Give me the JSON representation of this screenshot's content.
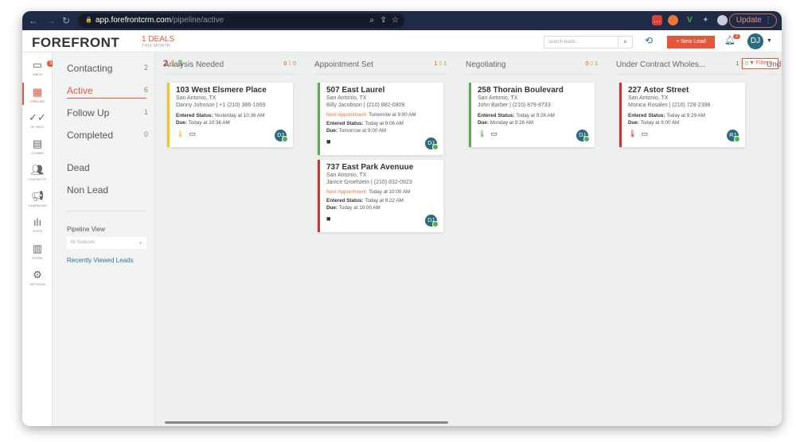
{
  "browser": {
    "url_host": "app.forefrontcrm.com",
    "url_path": "/pipeline/active",
    "update_label": "Update"
  },
  "header": {
    "logo": "FOREFRONT",
    "deals": "1 DEALS",
    "deals_sub": "THIS MONTH",
    "search_placeholder": "search leads...",
    "new_lead": "+ New Lead",
    "notif_count": "2",
    "user_initials": "DJ"
  },
  "rail": [
    {
      "label": "INBOX",
      "badge": "3"
    },
    {
      "label": "PIPELINE"
    },
    {
      "label": "UP NEXT"
    },
    {
      "label": "COMMS"
    },
    {
      "label": "CONTACTS"
    },
    {
      "label": "CAMPAIGNS"
    },
    {
      "label": "STATS"
    },
    {
      "label": "STORE"
    },
    {
      "label": "SETTINGS"
    }
  ],
  "statuses": [
    {
      "label": "Contacting",
      "count": "2"
    },
    {
      "label": "Active",
      "count": "6"
    },
    {
      "label": "Follow Up",
      "count": "1"
    },
    {
      "label": "Completed",
      "count": "0"
    },
    {
      "label": "Dead"
    },
    {
      "label": "Non Lead"
    }
  ],
  "pipeline_view": {
    "label": "Pipeline View",
    "value": "All Statuses",
    "recent": "Recently Viewed Leads"
  },
  "summary": {
    "red": "2",
    "yellow": "1",
    "green": "3"
  },
  "filters": "Filters",
  "columns": [
    {
      "title": "Analysis Needed",
      "counts": [
        "0",
        "1",
        "0"
      ],
      "cards": [
        {
          "address": "103 West Elsmere Place",
          "city": "San Antonio, TX",
          "contact": "Danny Johnson | +1 (210) 386-1069",
          "entered_label": "Entered Status:",
          "entered": "Yesterday at 10:36 AM",
          "due_label": "Due:",
          "due": "Today at 10:36 AM",
          "avatar": "DJ",
          "color": "#f2c230"
        }
      ]
    },
    {
      "title": "Appointment Set",
      "counts": [
        "1",
        "0",
        "1"
      ],
      "cards": [
        {
          "address": "507 East Laurel",
          "city": "San Antonio, TX",
          "contact": "Billy Jacobson | (210) 882-0909",
          "appt_label": "Next Appointment:",
          "appt": "Tomorrow at 9:00 AM",
          "entered_label": "Entered Status:",
          "entered": "Today at 9:06 AM",
          "due_label": "Due:",
          "due": "Tomorrow at 9:00 AM",
          "avatar": "DJ",
          "color": "#5cad52"
        },
        {
          "address": "737 East Park Avenuue",
          "city": "San Antonio, TX",
          "contact": "Janice Groelstein | (210) 832-0923",
          "appt_label": "Next Appointment:",
          "appt": "Today at 10:00 AM",
          "entered_label": "Entered Status:",
          "entered": "Today at 9:22 AM",
          "due_label": "Due:",
          "due": "Today at 10:00 AM",
          "avatar": "DJ",
          "color": "#c9352e"
        }
      ]
    },
    {
      "title": "Negotiating",
      "counts": [
        "0",
        "0",
        "1"
      ],
      "cards": [
        {
          "address": "258 Thorain Boulevard",
          "city": "San Antonio, TX",
          "contact": "John Barber | (210) 879-8733",
          "entered_label": "Entered Status:",
          "entered": "Today at 9:26 AM",
          "due_label": "Due:",
          "due": "Monday at 9:26 AM",
          "avatar": "DJ",
          "color": "#5cad52"
        }
      ]
    },
    {
      "title": "Under Contract Wholes...",
      "counts": [
        "1",
        "0",
        "0"
      ],
      "cards": [
        {
          "address": "227 Astor Street",
          "city": "San Antonio, TX",
          "contact": "Monica Rosales | (210) 728-2398",
          "entered_label": "Entered Status:",
          "entered": "Today at 9:29 AM",
          "due_label": "Due:",
          "due": "Today at 9:00 AM",
          "avatar": "RJ",
          "color": "#c9352e"
        }
      ]
    },
    {
      "title": "Und"
    }
  ]
}
